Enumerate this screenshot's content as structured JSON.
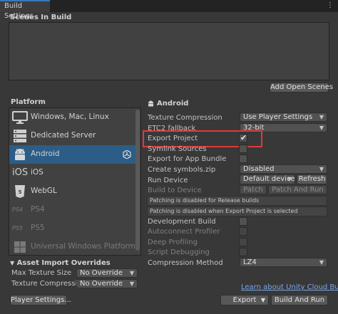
{
  "window": {
    "tab_title": "Build Settings",
    "menu_icon": "kebab-menu-icon"
  },
  "scenes": {
    "heading": "Scenes In Build",
    "add_open_scenes_label": "Add Open Scenes"
  },
  "platform": {
    "heading": "Platform",
    "items": [
      {
        "label": "Windows, Mac, Linux",
        "icon": "monitor-icon",
        "selected": false,
        "dimmed": false
      },
      {
        "label": "Dedicated Server",
        "icon": "server-icon",
        "selected": false,
        "dimmed": false
      },
      {
        "label": "Android",
        "icon": "android-icon",
        "selected": true,
        "dimmed": false
      },
      {
        "label": "iOS",
        "icon": "ios-icon",
        "selected": false,
        "dimmed": false
      },
      {
        "label": "WebGL",
        "icon": "html5-icon",
        "selected": false,
        "dimmed": false
      },
      {
        "label": "PS4",
        "icon": "ps4-icon",
        "selected": false,
        "dimmed": true
      },
      {
        "label": "PS5",
        "icon": "ps5-icon",
        "selected": false,
        "dimmed": true
      },
      {
        "label": "Universal Windows Platform",
        "icon": "windows-icon",
        "selected": false,
        "dimmed": true
      }
    ]
  },
  "asset_import": {
    "heading": "Asset Import Overrides",
    "max_texture_size_label": "Max Texture Size",
    "max_texture_size_value": "No Override",
    "texture_compression_label": "Texture Compression",
    "texture_compression_value": "No Override"
  },
  "android": {
    "heading": "Android",
    "texture_compression_label": "Texture Compression",
    "texture_compression_value": "Use Player Settings",
    "etc2_fallback_label": "ETC2 fallback",
    "etc2_fallback_value": "32-bit",
    "export_project_label": "Export Project",
    "export_project_checked": true,
    "symlink_sources_label": "Symlink Sources",
    "export_app_bundle_label": "Export for App Bundle",
    "create_symbols_label": "Create symbols.zip",
    "create_symbols_value": "Disabled",
    "run_device_label": "Run Device",
    "run_device_value": "Default device",
    "refresh_label": "Refresh",
    "build_to_device_label": "Build to Device",
    "patch_label": "Patch",
    "patch_and_run_label": "Patch And Run",
    "note_release": "Patching is disabled for Release builds",
    "note_export": "Patching is disabled when Export Project is selected",
    "development_build_label": "Development Build",
    "autoconnect_profiler_label": "Autoconnect Profiler",
    "deep_profiling_label": "Deep Profiling",
    "script_debugging_label": "Script Debugging",
    "compression_method_label": "Compression Method",
    "compression_method_value": "LZ4"
  },
  "footer": {
    "cloud_build_link": "Learn about Unity Cloud Build",
    "player_settings_label": "Player Settings...",
    "export_label": "Export",
    "build_and_run_label": "Build And Run"
  },
  "colors": {
    "selection": "#2c5d87",
    "highlight_box": "#e03a3a",
    "link": "#7aa7e6",
    "tab_accent": "#3a79bb"
  }
}
